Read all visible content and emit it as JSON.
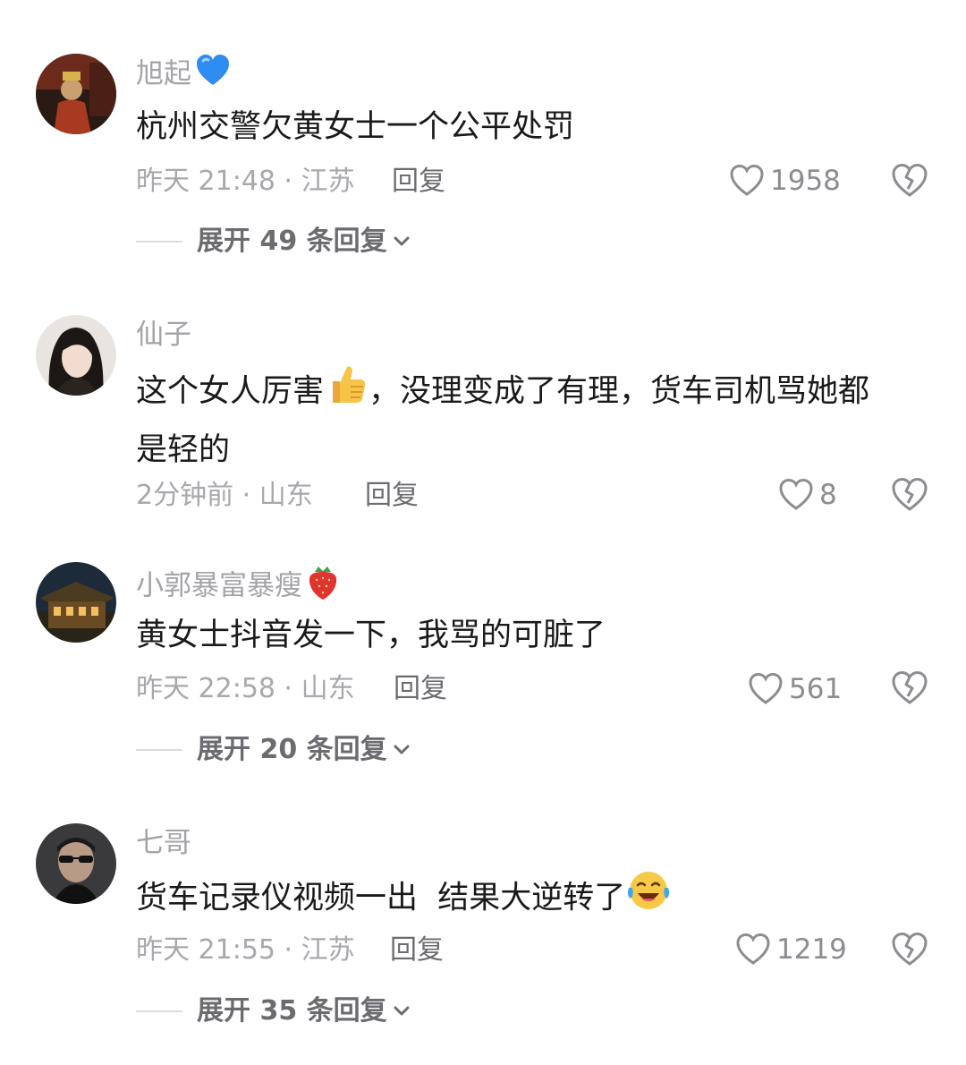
{
  "comments": [
    {
      "username": "旭起",
      "username_emoji": "blue-heart-icon",
      "text_lines": [
        "杭州交警欠黄女士一个公平处罚"
      ],
      "meta": "昨天 21:48 · 江苏",
      "reply_label": "回复",
      "likes": "1958",
      "expand_label": "展开 49 条回复"
    },
    {
      "username": "仙子",
      "text_before_emoji": "这个女人厉害",
      "content_emoji": "thumbs-up-icon",
      "text_after_emoji": "，没理变成了有理，货车司机骂她都",
      "text_line2": "是轻的",
      "meta": "2分钟前 · 山东",
      "reply_label": "回复",
      "likes": "8"
    },
    {
      "username": "小郭暴富暴瘦",
      "username_emoji": "strawberry-icon",
      "text_lines": [
        "黄女士抖音发一下，我骂的可脏了"
      ],
      "meta": "昨天 22:58 · 山东",
      "reply_label": "回复",
      "likes": "561",
      "expand_label": "展开 20 条回复"
    },
    {
      "username": "七哥",
      "text_before_emoji": "货车记录仪视频一出  结果大逆转了",
      "content_emoji": "laughing-tears-icon",
      "meta": "昨天 21:55 · 江苏",
      "reply_label": "回复",
      "likes": "1219",
      "expand_label": "展开 35 条回复"
    }
  ],
  "colors": {
    "text_primary": "#1a1a1a",
    "text_secondary": "#a8a8ad",
    "reply_text": "#6b6b70",
    "icon_gray": "#8c8c91"
  }
}
